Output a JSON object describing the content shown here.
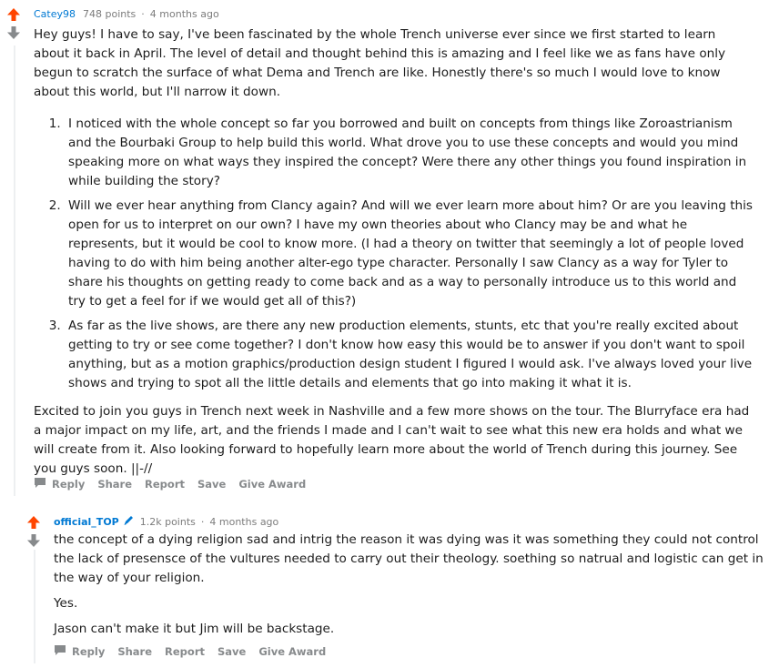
{
  "comments": [
    {
      "author": "Catey98",
      "points": "748 points",
      "sep": "·",
      "time": "4 months ago",
      "paragraphs": [
        "Hey guys! I have to say, I've been fascinated by the whole Trench universe ever since we first started to learn about it back in April. The level of detail and thought behind this is amazing and I feel like we as fans have only begun to scratch the surface of what Dema and Trench are like. Honestly there's so much I would love to know about this world, but I'll narrow it down."
      ],
      "list": [
        "I noticed with the whole concept so far you borrowed and built on concepts from things like Zoroastrianism and the Bourbaki Group to help build this world. What drove you to use these concepts and would you mind speaking more on what ways they inspired the concept? Were there any other things you found inspiration in while building the story?",
        "Will we ever hear anything from Clancy again? And will we ever learn more about him? Or are you leaving this open for us to interpret on our own? I have my own theories about who Clancy may be and what he represents, but it would be cool to know more. (I had a theory on twitter that seemingly a lot of people loved having to do with him being another alter-ego type character. Personally I saw Clancy as a way for Tyler to share his thoughts on getting ready to come back and as a way to personally introduce us to this world and try to get a feel for if we would get all of this?)",
        "As far as the live shows, are there any new production elements, stunts, etc that you're really excited about getting to try or see come together? I don't know how easy this would be to answer if you don't want to spoil anything, but as a motion graphics/production design student I figured I would ask. I've always loved your live shows and trying to spot all the little details and elements that go into making it what it is."
      ],
      "closing": "Excited to join you guys in Trench next week in Nashville and a few more shows on the tour. The Blurryface era had a major impact on my life, art, and the friends I made and I can't wait to see what this new era holds and what we will create from it. Also looking forward to hopefully learn more about the world of Trench during this journey. See you guys soon. ||-//",
      "actions": {
        "reply": "Reply",
        "share": "Share",
        "report": "Report",
        "save": "Save",
        "award": "Give Award"
      }
    },
    {
      "author": "official_TOP",
      "points": "1.2k points",
      "sep": "·",
      "time": "4 months ago",
      "paragraphs": [
        "the concept of a dying religion sad and intrig the reason it was dying was it was something they could not control the lack of presensce of the vultures needed to carry out their theology. soething so natrual and logistic can get in the way of your religion.",
        "Yes.",
        "Jason can't make it but Jim will be backstage."
      ],
      "actions": {
        "reply": "Reply",
        "share": "Share",
        "report": "Report",
        "save": "Save",
        "award": "Give Award"
      }
    }
  ],
  "colors": {
    "upvote": "#ff4500",
    "downvote": "#878a8c",
    "author": "#0079d3",
    "meta": "#7c7c7c"
  },
  "icons": {
    "upvote": "upvote-arrow-icon",
    "downvote": "downvote-arrow-icon",
    "reply": "comment-bubble-icon",
    "mod": "pen-icon"
  }
}
